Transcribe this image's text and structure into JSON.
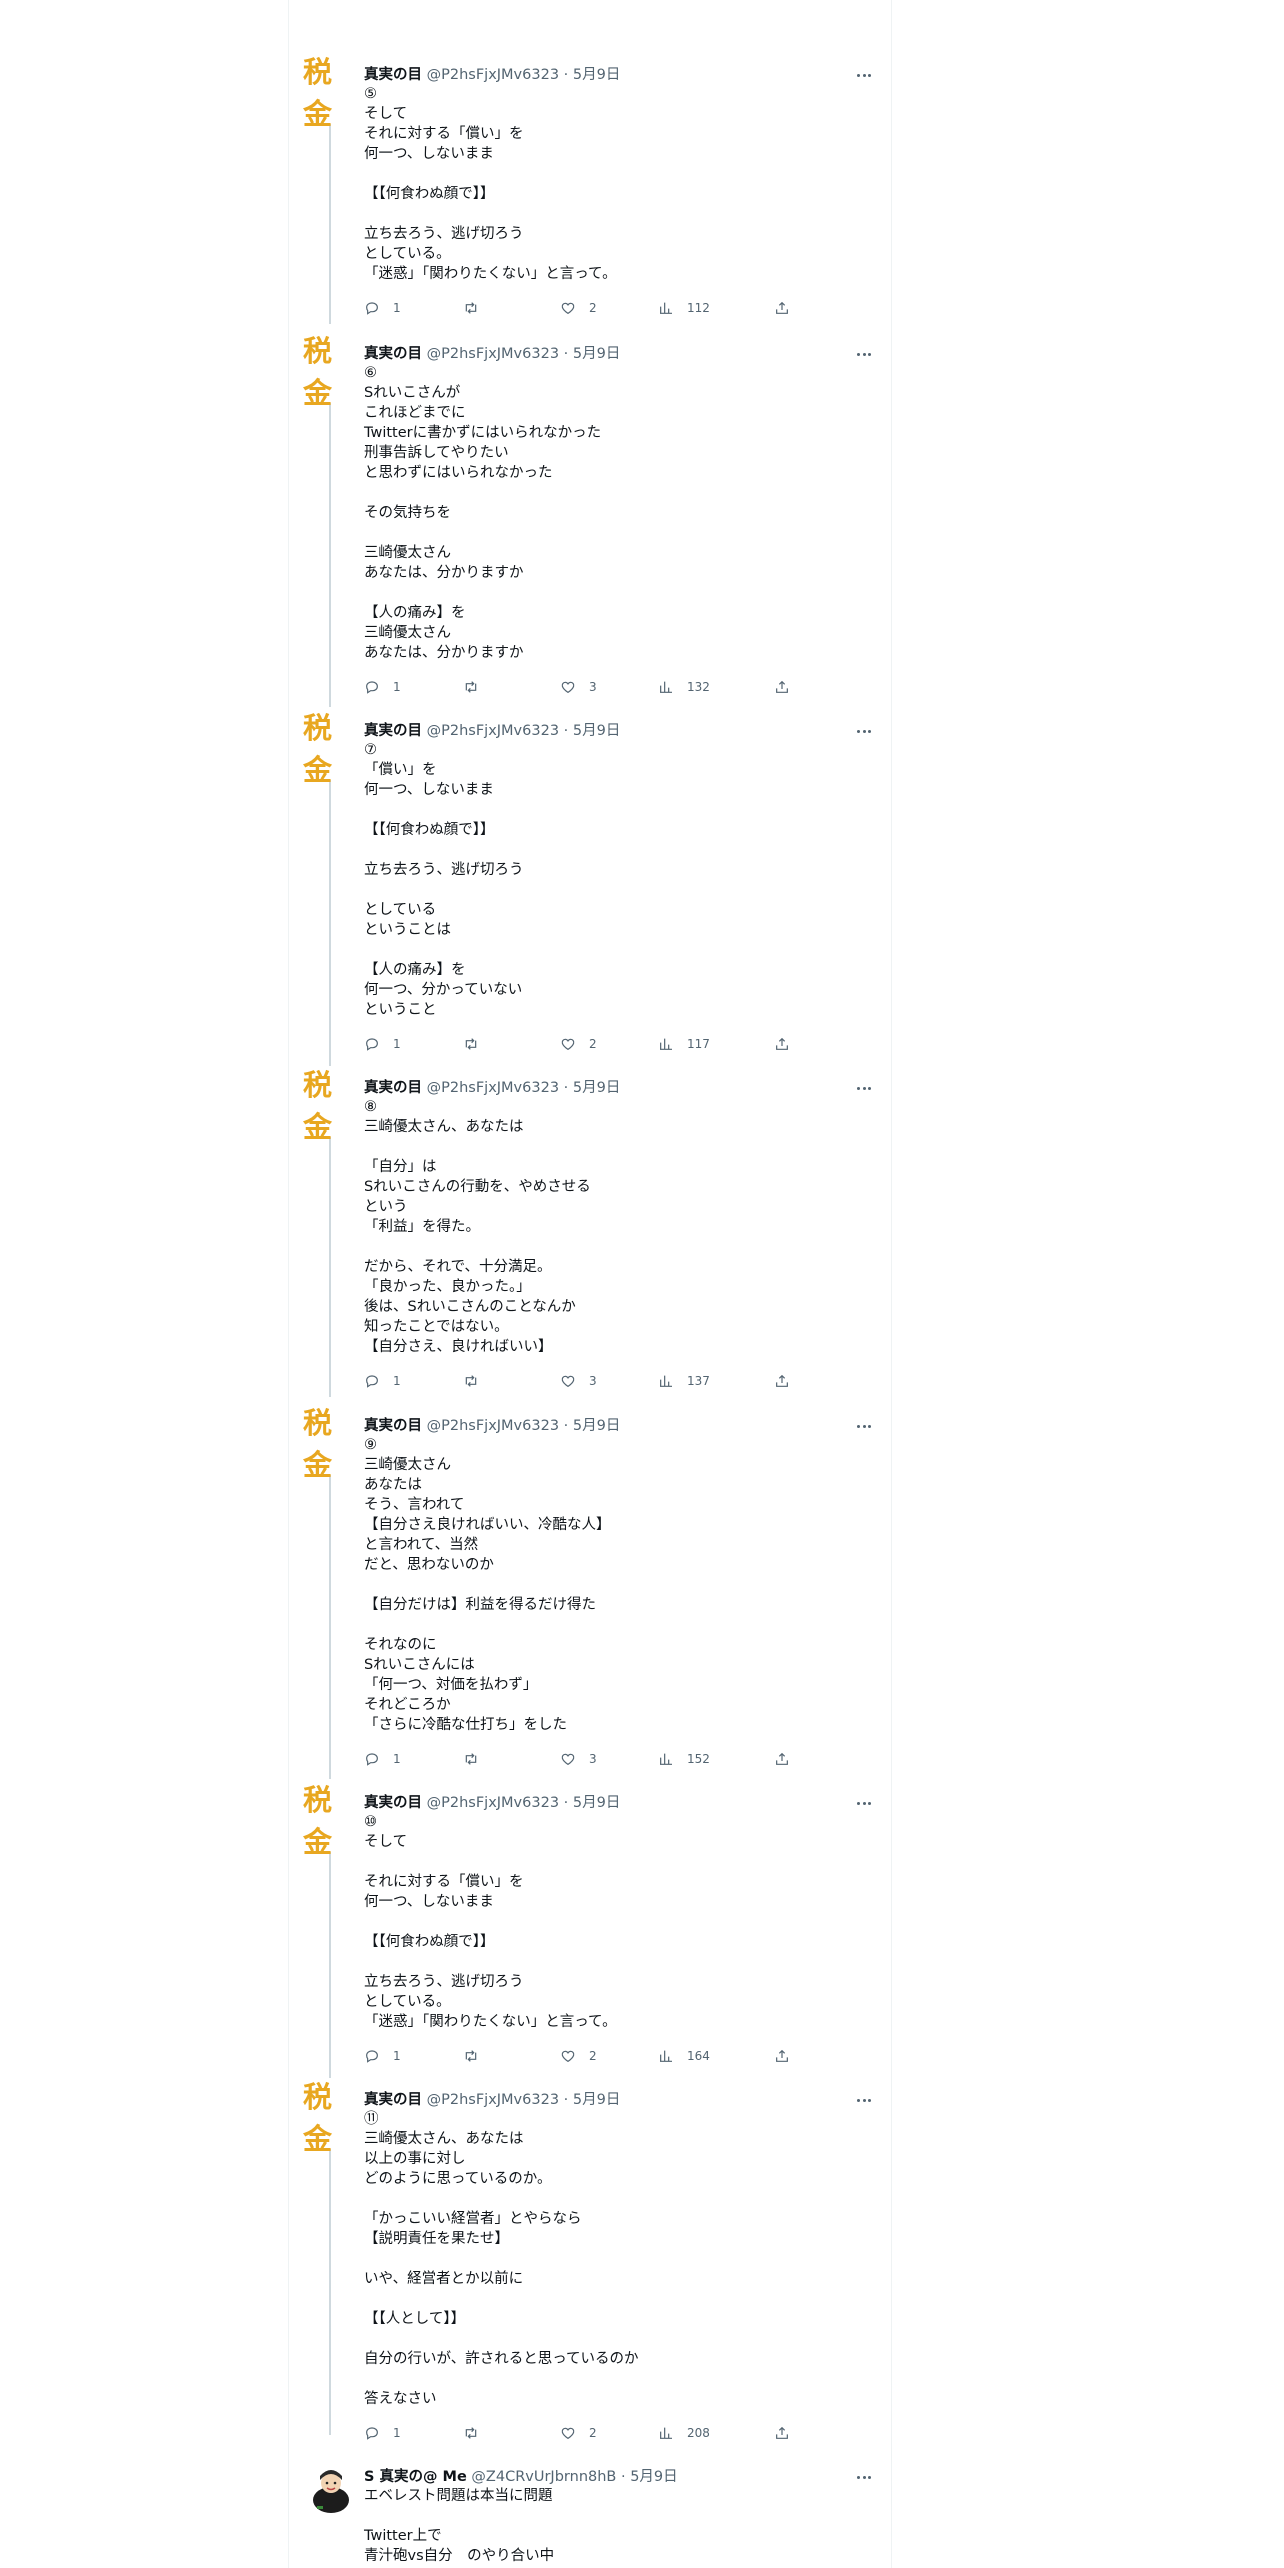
{
  "tweets": [
    {
      "avatar_text": "税金",
      "name": "真実の目",
      "handle": "@P2hsFjxJMv6323",
      "date": "· 5月9日",
      "text": "⑤\nそして\nそれに対する「償い」を\n何一つ、しないまま\n\n【【何食わぬ顔で】】\n\n立ち去ろう、逃げ切ろう\nとしている。\n「迷惑」「関わりたくない」と言って。",
      "replies": "1",
      "retweets": "",
      "likes": "2",
      "views": "112"
    },
    {
      "avatar_text": "税金",
      "name": "真実の目",
      "handle": "@P2hsFjxJMv6323",
      "date": "· 5月9日",
      "text": "⑥\nSれいこさんが\nこれほどまでに\nTwitterに書かずにはいられなかった\n刑事告訴してやりたい\nと思わずにはいられなかった\n\nその気持ちを\n\n三崎優太さん\nあなたは、分かりますか\n\n【人の痛み】を\n三崎優太さん\nあなたは、分かりますか",
      "replies": "1",
      "retweets": "",
      "likes": "3",
      "views": "132"
    },
    {
      "avatar_text": "税金",
      "name": "真実の目",
      "handle": "@P2hsFjxJMv6323",
      "date": "· 5月9日",
      "text": "⑦\n「償い」を\n何一つ、しないまま\n\n【【何食わぬ顔で】】\n\n立ち去ろう、逃げ切ろう\n\nとしている\nということは\n\n【人の痛み】を\n何一つ、分かっていない\nということ",
      "replies": "1",
      "retweets": "",
      "likes": "2",
      "views": "117"
    },
    {
      "avatar_text": "税金",
      "name": "真実の目",
      "handle": "@P2hsFjxJMv6323",
      "date": "· 5月9日",
      "text": "⑧\n三崎優太さん、あなたは\n\n「自分」は\nSれいこさんの行動を、やめさせる\nという\n「利益」を得た。\n\nだから、それで、十分満足。\n「良かった、良かった。」\n後は、Sれいこさんのことなんか\n知ったことではない。\n【自分さえ、良ければいい】",
      "replies": "1",
      "retweets": "",
      "likes": "3",
      "views": "137"
    },
    {
      "avatar_text": "税金",
      "name": "真実の目",
      "handle": "@P2hsFjxJMv6323",
      "date": "· 5月9日",
      "text": "⑨\n三崎優太さん\nあなたは\nそう、言われて\n【自分さえ良ければいい、冷酷な人】\nと言われて、当然\nだと、思わないのか\n\n【自分だけは】利益を得るだけ得た\n\nそれなのに\nSれいこさんには\n「何一つ、対価を払わず」\nそれどころか\n「さらに冷酷な仕打ち」をした",
      "replies": "1",
      "retweets": "",
      "likes": "3",
      "views": "152"
    },
    {
      "avatar_text": "税金",
      "name": "真実の目",
      "handle": "@P2hsFjxJMv6323",
      "date": "· 5月9日",
      "text": "⑩\nそして\n\nそれに対する「償い」を\n何一つ、しないまま\n\n【【何食わぬ顔で】】\n\n立ち去ろう、逃げ切ろう\nとしている。\n「迷惑」「関わりたくない」と言って。",
      "replies": "1",
      "retweets": "",
      "likes": "2",
      "views": "164"
    },
    {
      "avatar_text": "税金",
      "name": "真実の目",
      "handle": "@P2hsFjxJMv6323",
      "date": "· 5月9日",
      "text": "⑪\n三崎優太さん、あなたは\n以上の事に対し\nどのように思っているのか。\n\n「かっこいい経営者」とやらなら\n【説明責任を果たせ】\n\nいや、経営者とか以前に\n\n【【人として】】\n\n自分の行いが、許されると思っているのか\n\n答えなさい",
      "replies": "1",
      "retweets": "",
      "likes": "2",
      "views": "208"
    }
  ],
  "last_tweet": {
    "name": "S 真実の@ Me",
    "handle": "@Z4CRvUrJbrnn8hB",
    "date": "· 5月9日",
    "text": "エベレスト問題は本当に問題\n\nTwitter上で\n青汁砲vs自分　のやり合い中"
  }
}
